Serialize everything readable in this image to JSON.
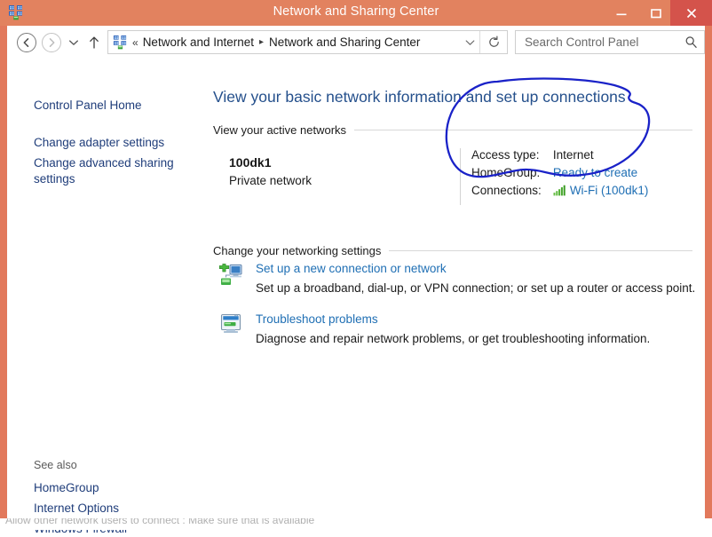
{
  "window": {
    "title": "Network and Sharing Center",
    "icon": "network-sharing-icon",
    "minimize_label": "Minimize",
    "maximize_label": "Maximize",
    "close_label": "Close",
    "frame_color": "#e2795c",
    "close_button_color": "#d4534b"
  },
  "toolbar": {
    "back_label": "Back",
    "forward_label": "Forward",
    "recent_label": "Recent locations",
    "up_label": "Up one level",
    "breadcrumb": {
      "leading": "«",
      "segments": [
        "Network and Internet",
        "Network and Sharing Center"
      ],
      "separator": "▸",
      "dropdown_label": "Previous locations",
      "refresh_label": "Refresh"
    },
    "search": {
      "value": "",
      "placeholder": "Search Control Panel",
      "icon": "search-icon"
    }
  },
  "sidebar": {
    "links": [
      {
        "label": "Control Panel Home"
      },
      {
        "label": "Change adapter settings"
      },
      {
        "label": "Change advanced sharing settings"
      }
    ],
    "see_also": {
      "heading": "See also",
      "links": [
        {
          "label": "HomeGroup"
        },
        {
          "label": "Internet Options"
        },
        {
          "label": "Windows Firewall"
        }
      ]
    }
  },
  "main": {
    "page_title": "View your basic network information and set up connections",
    "sections": {
      "active_networks": {
        "heading": "View your active networks",
        "network": {
          "name": "100dk1",
          "type": "Private network",
          "details": [
            {
              "label": "Access type:",
              "value": "Internet",
              "is_link": false
            },
            {
              "label": "HomeGroup:",
              "value": "Ready to create",
              "is_link": true
            },
            {
              "label": "Connections:",
              "value": "Wi-Fi (100dk1)",
              "is_link": true,
              "icon": "wifi-signal-bars-icon"
            }
          ]
        }
      },
      "networking_settings": {
        "heading": "Change your networking settings",
        "tasks": [
          {
            "icon": "add-network-connection-icon",
            "link": "Set up a new connection or network",
            "description": "Set up a broadband, dial-up, or VPN connection; or set up a router or access point."
          },
          {
            "icon": "troubleshoot-network-icon",
            "link": "Troubleshoot problems",
            "description": "Diagnose and repair network problems, or get troubleshooting information."
          }
        ]
      }
    }
  },
  "annotation": {
    "type": "hand-drawn-ellipse",
    "color": "#1a22c8",
    "target": "network connection details block"
  },
  "background": {
    "cut_off_text": "Allow other network users to connect : Make sure that is available"
  },
  "colors": {
    "link_blue": "#1f6fb4",
    "nav_blue": "#1f3d7a",
    "title_blue": "#25508c",
    "signal_green": "#4aa832"
  }
}
